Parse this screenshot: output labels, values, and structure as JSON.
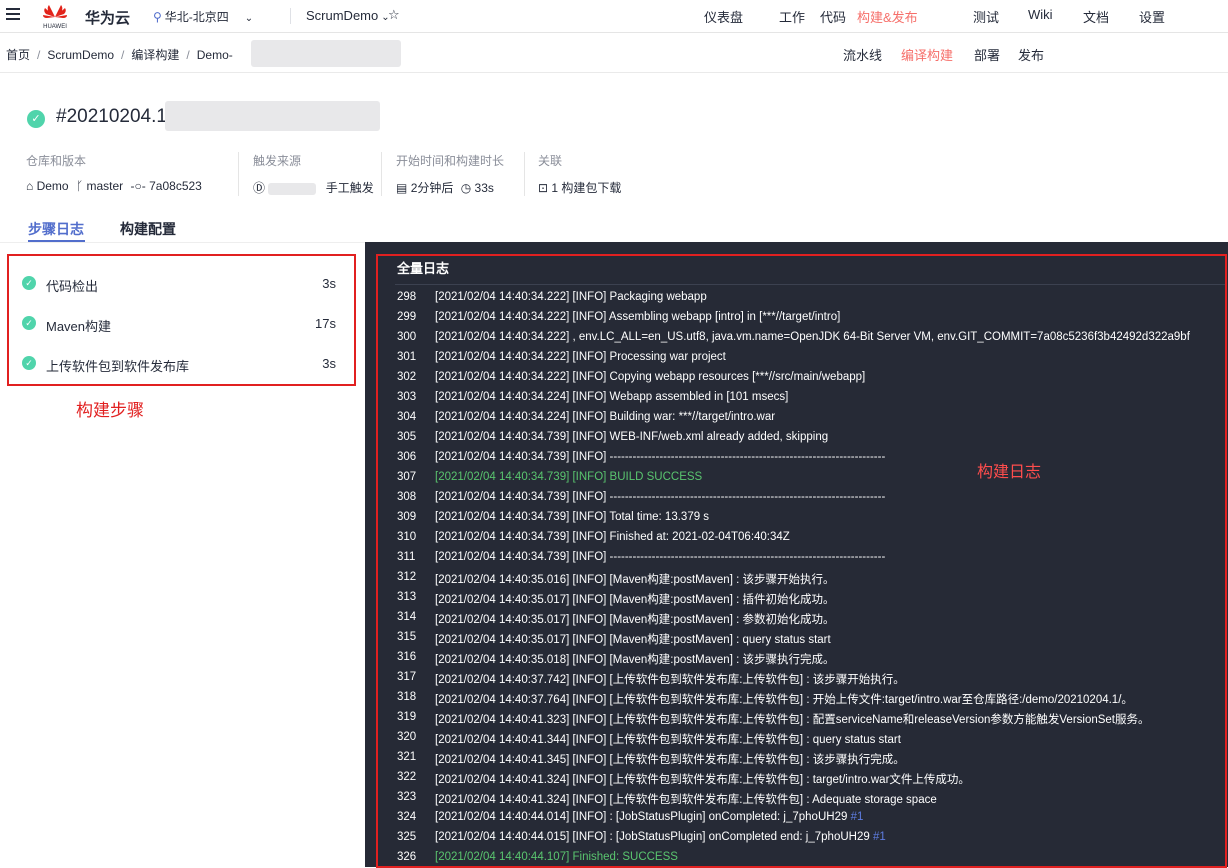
{
  "topbar": {
    "brand": "华为云",
    "logo_text": "HUAWEI",
    "region": "华北-北京四",
    "project": "ScrumDemo",
    "nav": [
      "仪表盘",
      "工作",
      "代码",
      "构建&发布",
      "测试",
      "Wiki",
      "文档",
      "设置"
    ],
    "active_nav": "构建&发布"
  },
  "breadcrumb": {
    "items": [
      "首页",
      "ScrumDemo",
      "编译构建",
      "Demo-"
    ],
    "separator": "/"
  },
  "subnav": {
    "items": [
      "流水线",
      "编译构建",
      "部署",
      "发布"
    ],
    "active": "编译构建"
  },
  "build": {
    "number": "#20210204.1",
    "meta": {
      "repo_label": "仓库和版本",
      "repo": "Demo",
      "branch": "master",
      "commit": "7a08c523",
      "trigger_label": "触发来源",
      "trigger": "手工触发",
      "time_label": "开始时间和构建时长",
      "start": "2分钟后",
      "duration": "33s",
      "related_label": "关联",
      "related": "1 构建包下载"
    }
  },
  "tabs": [
    "步骤日志",
    "构建配置"
  ],
  "steps": [
    {
      "name": "代码检出",
      "duration": "3s"
    },
    {
      "name": "Maven构建",
      "duration": "17s"
    },
    {
      "name": "上传软件包到软件发布库",
      "duration": "3s"
    }
  ],
  "annotations": {
    "steps": "构建步骤",
    "log": "构建日志"
  },
  "log": {
    "title": "全量日志",
    "lines": [
      {
        "n": "298",
        "text": "[2021/02/04 14:40:34.222] [INFO] Packaging webapp"
      },
      {
        "n": "299",
        "text": "[2021/02/04 14:40:34.222] [INFO] Assembling webapp [intro] in [***//target/intro]"
      },
      {
        "n": "300",
        "text": "[2021/02/04 14:40:34.222] , env.LC_ALL=en_US.utf8, java.vm.name=OpenJDK 64-Bit Server VM, env.GIT_COMMIT=7a08c5236f3b42492d322a9bf"
      },
      {
        "n": "301",
        "text": "[2021/02/04 14:40:34.222] [INFO] Processing war project"
      },
      {
        "n": "302",
        "text": "[2021/02/04 14:40:34.222] [INFO] Copying webapp resources [***//src/main/webapp]"
      },
      {
        "n": "303",
        "text": "[2021/02/04 14:40:34.224] [INFO] Webapp assembled in [101 msecs]"
      },
      {
        "n": "304",
        "text": "[2021/02/04 14:40:34.224] [INFO] Building war: ***//target/intro.war"
      },
      {
        "n": "305",
        "text": "[2021/02/04 14:40:34.739] [INFO] WEB-INF/web.xml already added, skipping"
      },
      {
        "n": "306",
        "text": "[2021/02/04 14:40:34.739] [INFO] ------------------------------------------------------------------------"
      },
      {
        "n": "307",
        "text": "[2021/02/04 14:40:34.739] [INFO] BUILD SUCCESS",
        "success": true
      },
      {
        "n": "308",
        "text": "[2021/02/04 14:40:34.739] [INFO] ------------------------------------------------------------------------"
      },
      {
        "n": "309",
        "text": "[2021/02/04 14:40:34.739] [INFO] Total time: 13.379 s"
      },
      {
        "n": "310",
        "text": "[2021/02/04 14:40:34.739] [INFO] Finished at: 2021-02-04T06:40:34Z"
      },
      {
        "n": "311",
        "text": "[2021/02/04 14:40:34.739] [INFO] ------------------------------------------------------------------------"
      },
      {
        "n": "312",
        "text": "[2021/02/04 14:40:35.016] [INFO] [Maven构建:postMaven] : 该步骤开始执行。"
      },
      {
        "n": "313",
        "text": "[2021/02/04 14:40:35.017] [INFO] [Maven构建:postMaven] : 插件初始化成功。"
      },
      {
        "n": "314",
        "text": "[2021/02/04 14:40:35.017] [INFO] [Maven构建:postMaven] : 参数初始化成功。"
      },
      {
        "n": "315",
        "text": "[2021/02/04 14:40:35.017] [INFO] [Maven构建:postMaven] : query status start"
      },
      {
        "n": "316",
        "text": "[2021/02/04 14:40:35.018] [INFO] [Maven构建:postMaven] : 该步骤执行完成。"
      },
      {
        "n": "317",
        "text": "[2021/02/04 14:40:37.742] [INFO] [上传软件包到软件发布库:上传软件包] : 该步骤开始执行。"
      },
      {
        "n": "318",
        "text": "[2021/02/04 14:40:37.764] [INFO] [上传软件包到软件发布库:上传软件包] : 开始上传文件:target/intro.war至仓库路径:/demo/20210204.1/。"
      },
      {
        "n": "319",
        "text": "[2021/02/04 14:40:41.323] [INFO] [上传软件包到软件发布库:上传软件包] : 配置serviceName和releaseVersion参数方能触发VersionSet服务。"
      },
      {
        "n": "320",
        "text": "[2021/02/04 14:40:41.344] [INFO] [上传软件包到软件发布库:上传软件包] : query status start"
      },
      {
        "n": "321",
        "text": "[2021/02/04 14:40:41.345] [INFO] [上传软件包到软件发布库:上传软件包] : 该步骤执行完成。"
      },
      {
        "n": "322",
        "text": "[2021/02/04 14:40:41.324] [INFO] [上传软件包到软件发布库:上传软件包] : target/intro.war文件上传成功。"
      },
      {
        "n": "323",
        "text": "[2021/02/04 14:40:41.324] [INFO] [上传软件包到软件发布库:上传软件包] : Adequate storage space"
      },
      {
        "n": "324",
        "text": "[2021/02/04 14:40:44.014] [INFO]  : [JobStatusPlugin] onCompleted: j_7phoUH29 ",
        "link": "#1"
      },
      {
        "n": "325",
        "text": "[2021/02/04 14:40:44.015] [INFO]  : [JobStatusPlugin] onCompleted end: j_7phoUH29 ",
        "link": "#1"
      },
      {
        "n": "326",
        "text": "[2021/02/04 14:40:44.107] Finished: SUCCESS",
        "success": true
      }
    ]
  },
  "colors": {
    "accent": "#f66f6a",
    "primary": "#526ecc",
    "success": "#50d4ab",
    "log_bg": "#262a36",
    "log_success": "#5ac56f",
    "annotation": "#e12020"
  }
}
